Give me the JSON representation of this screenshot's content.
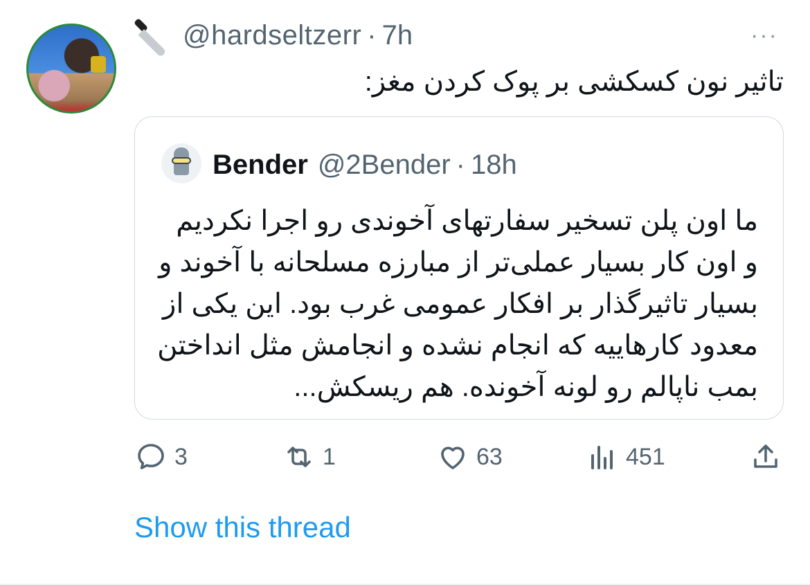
{
  "tweet": {
    "handle": "@hardseltzerr",
    "separator": "·",
    "time": "7h",
    "text": "تاثیر نون کسکشی بر پوک کردن مغز:",
    "more_label": "···"
  },
  "quote": {
    "name": "Bender",
    "handle": "@2Bender",
    "separator": "·",
    "time": "18h",
    "text": "ما اون پلن تسخیر سفارتهای آخوندی رو اجرا نکردیم و اون کار بسیار عملی‌تر از مبارزه مسلحانه با آخوند و بسیار تاثیرگذار بر افکار عمومی غرب بود. این یکی از معدود کارهاییه که انجام نشده و انجامش مثل انداختن بمب ناپالم رو لونه آخونده. هم ریسکش..."
  },
  "actions": {
    "replies": "3",
    "retweets": "1",
    "likes": "63",
    "views": "451"
  },
  "show_thread": "Show this thread",
  "colors": {
    "link": "#1d9bf0",
    "secondary": "#536471",
    "border": "#cfd9de"
  }
}
